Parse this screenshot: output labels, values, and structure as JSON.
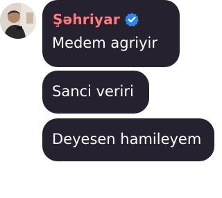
{
  "sender": {
    "name": "Şəhriyar",
    "name_color": "#ff7a7f",
    "verified": true
  },
  "colors": {
    "bubble_background": "#25212f",
    "text": "#ffffff",
    "verified_badge": "#2f86ea"
  },
  "messages": [
    {
      "text": "Medem agriyir"
    },
    {
      "text": "Sanci veriri"
    },
    {
      "text": "Deyesen hamileyem"
    }
  ]
}
